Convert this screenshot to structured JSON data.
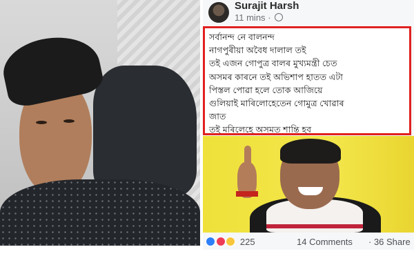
{
  "post": {
    "author": "Surajit Harsh",
    "timestamp": "11 mins",
    "separator": "·",
    "text_lines": [
      "সৰ্বানন্দ নে বালনন্দ",
      "নাগপুৰীয়া অবৈধ দালাল তই",
      "তই এজন গোপুত্ৰ বালৰ মুখ্যমন্ত্ৰী চেত",
      "অসমৰ কাৰনে তই অভিশাপ হাতত এটা",
      "পিস্তল পোৱা হলে তোক আজিয়ে",
      "গুলিয়াই মাৰিলোহেতেন গোমুত্ৰ খোৱাৰ",
      "জাত",
      "তই মৰিলেহে অসমত শান্তি হব"
    ],
    "reaction_count": "225",
    "comments": "14 Comments",
    "shares": "· 36 Share"
  },
  "icons": {
    "privacy": "globe-icon",
    "reactions": [
      "like-icon",
      "love-icon",
      "wow-icon"
    ]
  },
  "colors": {
    "highlight_border": "#e02020",
    "photo_background": "#efe13a"
  }
}
